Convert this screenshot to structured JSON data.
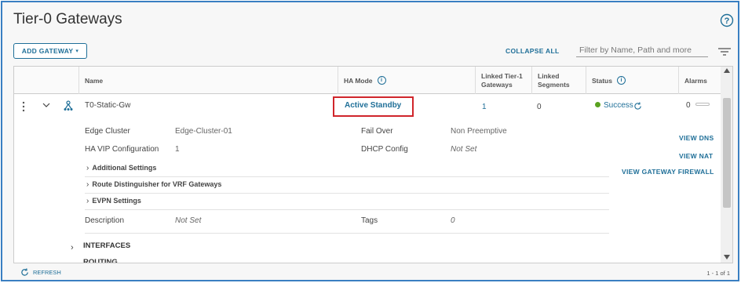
{
  "page": {
    "title": "Tier-0 Gateways"
  },
  "toolbar": {
    "add_gateway_label": "ADD GATEWAY",
    "collapse_all_label": "COLLAPSE ALL",
    "filter_placeholder": "Filter by Name, Path and more"
  },
  "columns": {
    "name": "Name",
    "ha_mode": "HA Mode",
    "linked_tier1_line1": "Linked Tier-1",
    "linked_tier1_line2": "Gateways",
    "linked_segments_line1": "Linked",
    "linked_segments_line2": "Segments",
    "status": "Status",
    "alarms": "Alarms"
  },
  "row": {
    "name": "T0-Static-Gw",
    "ha_mode": "Active Standby",
    "linked_tier1": "1",
    "linked_segments": "0",
    "status": "Success",
    "alarms": "0"
  },
  "details": {
    "edge_cluster_label": "Edge Cluster",
    "edge_cluster_value": "Edge-Cluster-01",
    "fail_over_label": "Fail Over",
    "fail_over_value": "Non Preemptive",
    "ha_vip_label": "HA VIP Configuration",
    "ha_vip_value": "1",
    "dhcp_label": "DHCP Config",
    "dhcp_value": "Not Set",
    "additional_settings": "Additional Settings",
    "route_distinguisher": "Route Distinguisher for VRF Gateways",
    "evpn_settings": "EVPN Settings",
    "description_label": "Description",
    "description_value": "Not Set",
    "tags_label": "Tags",
    "tags_value": "0",
    "interfaces": "INTERFACES",
    "routing": "ROUTING"
  },
  "side_links": {
    "view_dns": "VIEW DNS",
    "view_nat": "VIEW NAT",
    "view_gateway_firewall": "VIEW GATEWAY FIREWALL"
  },
  "footer": {
    "refresh_label": "REFRESH",
    "pagination": "1 - 1 of 1"
  },
  "colors": {
    "accent": "#1f6f98",
    "highlight_box": "#d0252b",
    "success": "#5aa220",
    "frame_border": "#3a7fc2"
  },
  "icons": [
    "help-icon",
    "chevron-down-icon",
    "filter-icon",
    "kebab-icon",
    "gateway-icon",
    "info-icon",
    "refresh-icon",
    "chevron-right-icon"
  ]
}
